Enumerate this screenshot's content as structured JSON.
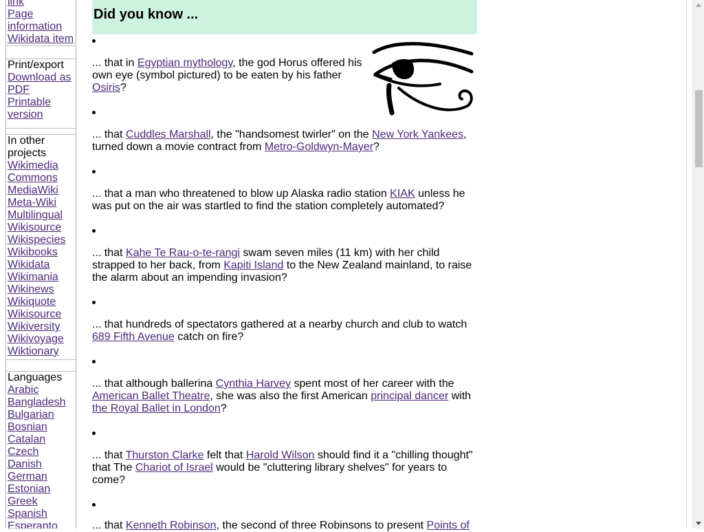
{
  "sidebar": {
    "tools": [
      {
        "label": "link"
      },
      {
        "label": "Page information"
      },
      {
        "label": "Wikidata item"
      }
    ],
    "print_export": {
      "heading": "Print/export",
      "items": [
        {
          "label": "Download as PDF"
        },
        {
          "label": "Printable version"
        }
      ]
    },
    "other_projects": {
      "heading": "In other projects",
      "items": [
        {
          "label": "Wikimedia Commons"
        },
        {
          "label": "MediaWiki"
        },
        {
          "label": "Meta-Wiki"
        },
        {
          "label": "Multilingual Wikisource"
        },
        {
          "label": "Wikispecies"
        },
        {
          "label": "Wikibooks"
        },
        {
          "label": "Wikidata"
        },
        {
          "label": "Wikimania"
        },
        {
          "label": "Wikinews"
        },
        {
          "label": "Wikiquote"
        },
        {
          "label": "Wikisource"
        },
        {
          "label": "Wikiversity"
        },
        {
          "label": "Wikivoyage"
        },
        {
          "label": "Wiktionary"
        }
      ]
    },
    "languages": {
      "heading": "Languages",
      "items": [
        {
          "label": "Arabic"
        },
        {
          "label": "Bangladesh"
        },
        {
          "label": "Bulgarian"
        },
        {
          "label": "Bosnian"
        },
        {
          "label": "Catalan"
        },
        {
          "label": "Czech"
        },
        {
          "label": "Danish"
        },
        {
          "label": "German"
        },
        {
          "label": "Estonian"
        },
        {
          "label": "Greek"
        },
        {
          "label": "Spanish"
        },
        {
          "label": "Esperanto"
        }
      ]
    }
  },
  "dyk": {
    "heading": "Did you know ...",
    "image_alt_icon": "eye-of-horus-icon",
    "items": [
      {
        "t1": "... that in ",
        "l1": "Egyptian mythology",
        "t2": ", the god Horus offered his own eye (symbol pictured) to be eaten by his father ",
        "l2": "Osiris",
        "t3": "?"
      },
      {
        "t1": "... that ",
        "l1": "Cuddles Marshall",
        "t2": ", the \"handsomest twirler\" on the ",
        "l2": "New York Yankees",
        "t3": ", turned down a movie contract from ",
        "l3": "Metro-Goldwyn-Mayer",
        "t4": "?"
      },
      {
        "t1": "... that a man who threatened to blow up Alaska radio station ",
        "l1": "KIAK",
        "t2": " unless he was put on the air was startled to find the station completely automated?"
      },
      {
        "t1": "... that ",
        "l1": "Kahe Te Rau-o-te-rangi",
        "t2": " swam seven miles (11 km) with her child strapped to her back, from ",
        "l2": "Kapiti Island",
        "t3": " to the New Zealand mainland, to raise the alarm about an impending invasion?"
      },
      {
        "t1": "... that hundreds of spectators gathered at a nearby church and club to watch ",
        "l1": "689 Fifth Avenue",
        "t2": " catch on fire?"
      },
      {
        "t1": "... that although ballerina ",
        "l1": "Cynthia Harvey",
        "t2": " spent most of her career with the ",
        "l2": "American Ballet Theatre",
        "t3": ", she was also the first American ",
        "l3": "principal dancer",
        "t4": " with ",
        "l4": "the Royal Ballet in London",
        "t5": "?"
      },
      {
        "t1": "... that ",
        "l1": "Thurston Clarke",
        "t2": " felt that ",
        "l2": "Harold Wilson",
        "t3": " should find it a \"chilling thought\" that The ",
        "l3": "Chariot of Israel",
        "t4": " would be \"cluttering library shelves\" for years to come?"
      },
      {
        "t1": "... that ",
        "l1": "Kenneth Robinson",
        "t2": ", the second of three Robinsons to present ",
        "l2": "Points of"
      }
    ]
  }
}
